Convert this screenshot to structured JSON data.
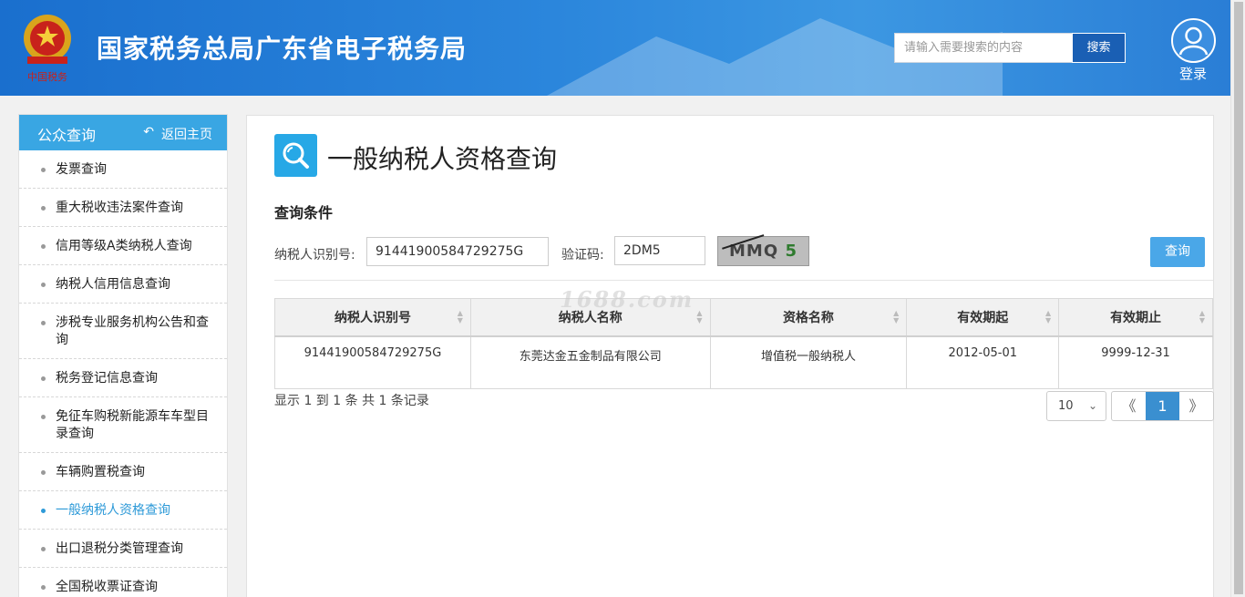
{
  "header": {
    "emblem_text": "中国税务",
    "site_title": "国家税务总局广东省电子税务局",
    "search_placeholder": "请输入需要搜索的内容",
    "search_button": "搜索",
    "login_label": "登录",
    "colors": {
      "header_bg": "#2b86dc",
      "search_button_bg": "#1a5fb4"
    }
  },
  "sidebar": {
    "title": "公众查询",
    "back_label": "返回主页",
    "items": [
      {
        "label": "发票查询"
      },
      {
        "label": "重大税收违法案件查询"
      },
      {
        "label": "信用等级A类纳税人查询"
      },
      {
        "label": "纳税人信用信息查询"
      },
      {
        "label": "涉税专业服务机构公告和查询"
      },
      {
        "label": "税务登记信息查询"
      },
      {
        "label": "免征车购税新能源车车型目录查询"
      },
      {
        "label": "车辆购置税查询"
      },
      {
        "label": "一般纳税人资格查询",
        "active": true
      },
      {
        "label": "出口退税分类管理查询"
      },
      {
        "label": "全国税收票证查询"
      }
    ],
    "colors": {
      "head_bg": "#39a6e3",
      "active": "#2e9ad8"
    }
  },
  "main": {
    "page_title": "一般纳税人资格查询",
    "conditions_title": "查询条件",
    "taxpayer_id_label": "纳税人识别号:",
    "taxpayer_id_value": "91441900584729275G",
    "captcha_label": "验证码:",
    "captcha_value": "2DM5",
    "captcha_image_text": "MMQ",
    "captcha_image_digit": "5",
    "query_button": "查询",
    "table": {
      "columns": [
        "纳税人识别号",
        "纳税人名称",
        "资格名称",
        "有效期起",
        "有效期止"
      ],
      "rows": [
        [
          "91441900584729275G",
          "东莞达金五金制品有限公司",
          "增值税一般纳税人",
          "2012-05-01",
          "9999-12-31"
        ]
      ]
    },
    "record_info": "显示 1 到 1 条 共 1 条记录",
    "page_size": "10",
    "pager": {
      "prev": "《",
      "current": "1",
      "next": "》"
    },
    "watermark": "1688.com"
  }
}
